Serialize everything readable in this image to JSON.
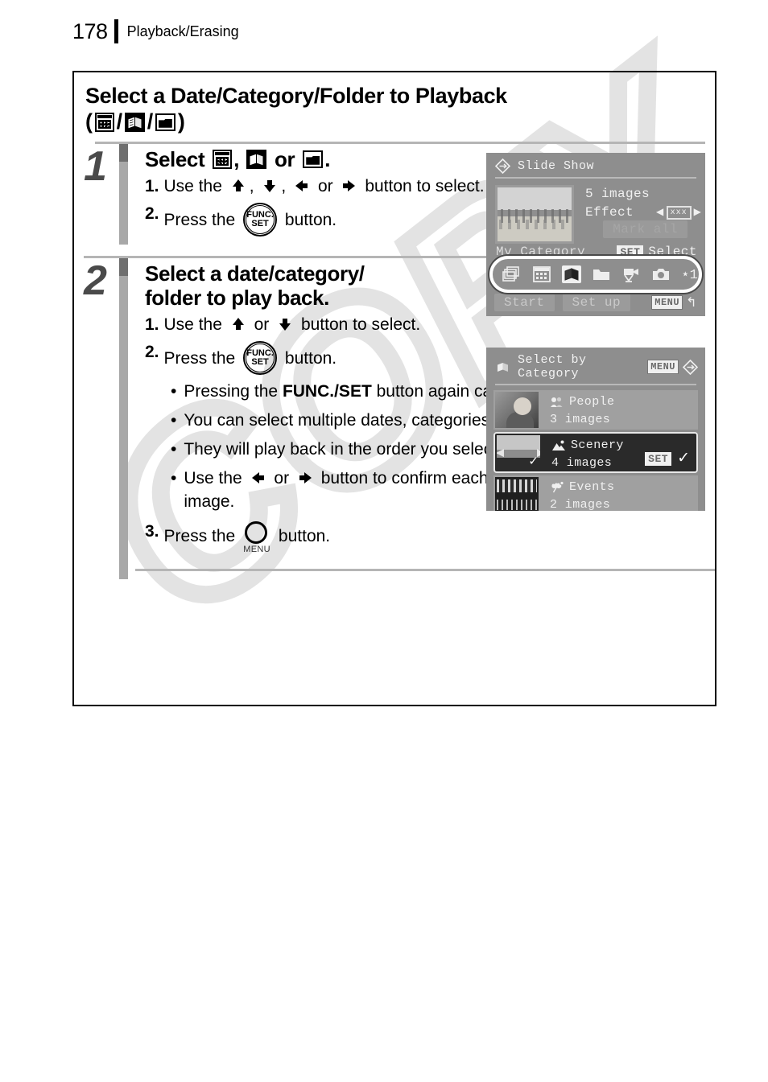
{
  "page": {
    "number": "178",
    "running_head": "Playback/Erasing",
    "watermark": "COPY"
  },
  "section": {
    "title_line1": "Select a Date/Category/Folder to Playback",
    "title_icons": [
      "calendar-icon",
      "category-book-icon",
      "folder-icon"
    ],
    "paren_open": "(",
    "paren_close": ")",
    "slash": "/"
  },
  "steps": [
    {
      "number": "1",
      "heading_prefix": "Select",
      "heading_comma": ",",
      "heading_or": "or",
      "heading_period": ".",
      "heading_icons": [
        "calendar-icon",
        "category-book-icon",
        "folder-icon"
      ],
      "substeps": [
        {
          "marker": "1.",
          "parts": [
            "Use the",
            ",",
            ",",
            "or",
            "button to select."
          ],
          "icons": [
            "up-arrow-icon",
            "down-arrow-icon",
            "left-arrow-icon",
            "right-arrow-icon"
          ]
        },
        {
          "marker": "2.",
          "parts": [
            "Press the",
            "button."
          ],
          "icons": [
            "func-set-button-icon"
          ]
        }
      ]
    },
    {
      "number": "2",
      "heading": "Select a date/category/ folder to play back.",
      "heading_l1": "Select a date/category/",
      "heading_l2": "folder to play back.",
      "substeps": [
        {
          "marker": "1.",
          "parts": [
            "Use the",
            "or",
            "button to select."
          ],
          "icons": [
            "up-arrow-icon",
            "down-arrow-icon"
          ]
        },
        {
          "marker": "2.",
          "parts": [
            "Press the",
            "button."
          ],
          "icons": [
            "func-set-button-icon"
          ]
        },
        {
          "marker": "3.",
          "parts": [
            "Press the",
            "button."
          ],
          "icons": [
            "menu-button-icon"
          ]
        }
      ],
      "bullets": [
        {
          "pre": "Pressing the ",
          "bold": "FUNC./SET",
          "post": " button again cancels the setting."
        },
        {
          "pre": "You can select multiple dates, categories, or folders.",
          "bold": "",
          "post": ""
        },
        {
          "pre": "They will play back in the order you select them.",
          "bold": "",
          "post": ""
        },
        {
          "pre": "Use the ",
          "bold": "",
          "post": " button to confirm each date, category or folder image.",
          "inline_icons": [
            "left-arrow-icon",
            "right-arrow-icon"
          ],
          "mid": " or "
        }
      ]
    }
  ],
  "lcd_slideshow": {
    "title": "Slide Show",
    "images_count": "5 images",
    "effect_label": "Effect",
    "effect_value": "xxx",
    "mark_all": "Mark all",
    "my_category": "My Category",
    "set_badge": "SET",
    "set_action": "Select",
    "start_button": "Start",
    "setup_button": "Set up",
    "menu_badge": "MENU",
    "return_glyph": "↰",
    "icon_row": [
      {
        "name": "all-images-icon",
        "selected": false
      },
      {
        "name": "calendar-icon",
        "selected": false
      },
      {
        "name": "category-book-icon",
        "selected": true
      },
      {
        "name": "folder-icon",
        "selected": false
      },
      {
        "name": "movie-icon",
        "selected": false
      },
      {
        "name": "still-image-icon",
        "selected": false
      }
    ],
    "icon_row_label": "⋆1"
  },
  "lcd_category": {
    "title": "Select by Category",
    "menu_badge": "MENU",
    "rows": [
      {
        "name": "People",
        "count": "3 images",
        "selected": false,
        "glyph": "people-icon"
      },
      {
        "name": "Scenery",
        "count": "4 images",
        "selected": true,
        "glyph": "scenery-icon",
        "set_badge": "SET",
        "check": "✓"
      },
      {
        "name": "Events",
        "count": "2 images",
        "selected": false,
        "glyph": "events-icon"
      }
    ]
  }
}
